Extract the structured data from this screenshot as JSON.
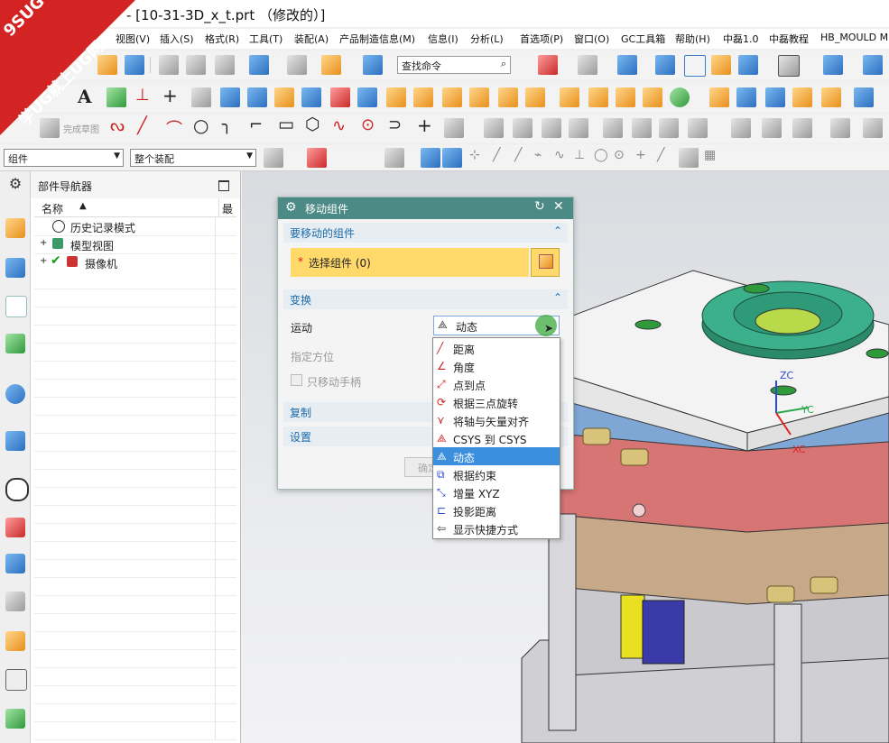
{
  "window": {
    "title": "- [10-31-3D_x_t.prt （修改的）]"
  },
  "watermark": {
    "line1": "9SUG",
    "line2": "学UG就上UG网"
  },
  "menu": [
    "视图(V)",
    "插入(S)",
    "格式(R)",
    "工具(T)",
    "装配(A)",
    "产品制造信息(M)",
    "信息(I)",
    "分析(L)",
    "首选项(P)",
    "窗口(O)",
    "GC工具箱",
    "帮助(H)",
    "中磊1.0",
    "中磊教程",
    "HB_MOULD M"
  ],
  "toolbar": {
    "find_placeholder": "查找命令",
    "sketch_done": "完成草图"
  },
  "selection_bar": {
    "filter": "组件",
    "scope": "整个装配"
  },
  "navigator": {
    "title": "部件导航器",
    "col_name": "名称",
    "col_latest": "最",
    "rows": [
      "历史记录模式",
      "模型视图",
      "摄像机"
    ]
  },
  "dialog": {
    "title": "移动组件",
    "section_components": "要移动的组件",
    "select_component": "选择组件 (0)",
    "required_mark": "*",
    "section_transform": "变换",
    "motion_label": "运动",
    "motion_value": "动态",
    "orient_label": "指定方位",
    "handle_only_label": "只移动手柄",
    "section_copy": "复制",
    "section_settings": "设置",
    "ok_partial": "确定"
  },
  "dropdown": {
    "items": [
      "距离",
      "角度",
      "点到点",
      "根据三点旋转",
      "将轴与矢量对齐",
      "CSYS 到 CSYS",
      "动态",
      "根据约束",
      "增量 XYZ",
      "投影距离",
      "显示快捷方式"
    ],
    "selected_index": 6
  },
  "triad": {
    "z": "ZC",
    "y": "YC",
    "x": "XC"
  },
  "colors": {
    "dialog_title": "#4c8a86",
    "section_text": "#1c6aa8",
    "select_highlight": "#ffd96a",
    "dropdown_selected": "#3c8fdc",
    "watermark": "#d32323"
  }
}
